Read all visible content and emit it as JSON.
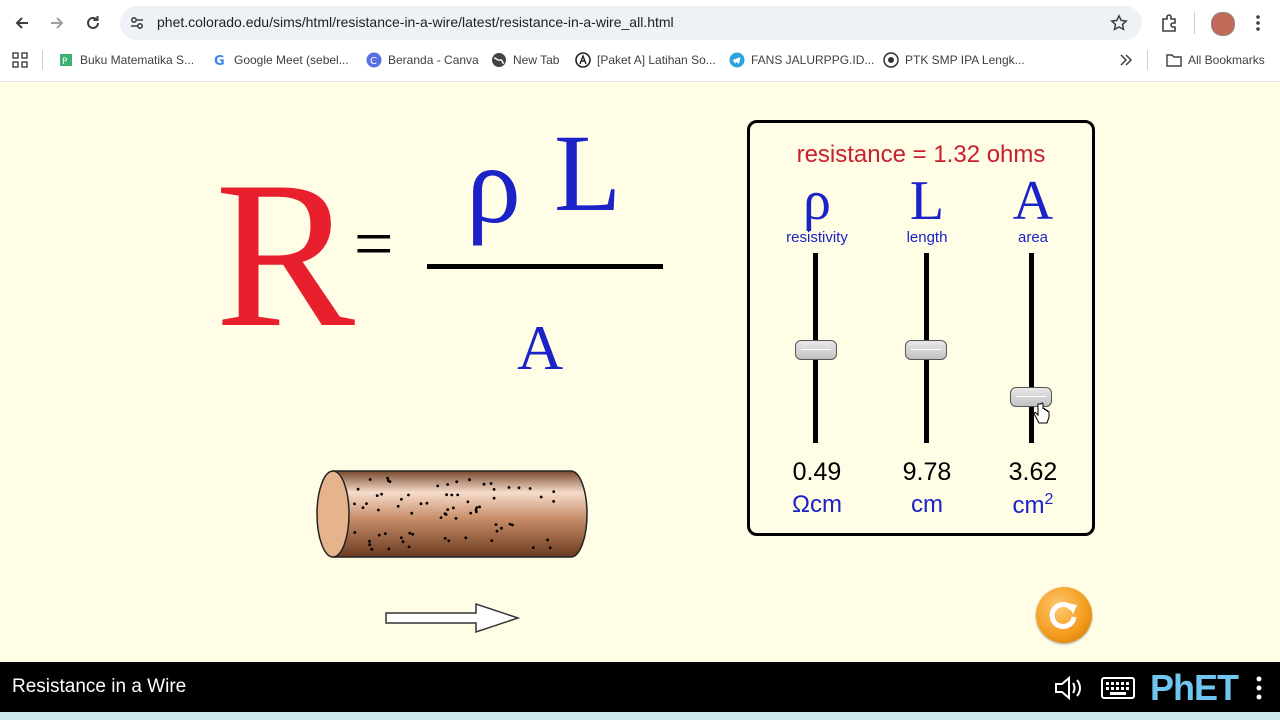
{
  "browser": {
    "url": "phet.colorado.edu/sims/html/resistance-in-a-wire/latest/resistance-in-a-wire_all.html",
    "bookmarks": [
      {
        "label": "Buku Matematika S...",
        "icon": "buku-favicon"
      },
      {
        "label": "Google Meet (sebel...",
        "icon": "google-icon"
      },
      {
        "label": "Beranda - Canva",
        "icon": "canva-icon"
      },
      {
        "label": "New Tab",
        "icon": "globe-icon"
      },
      {
        "label": "[Paket A] Latihan So...",
        "icon": "paket-favicon"
      },
      {
        "label": "FANS JALURPPG.ID...",
        "icon": "telegram-icon"
      },
      {
        "label": "PTK SMP IPA Lengk...",
        "icon": "ptk-favicon"
      }
    ],
    "all_bookmarks": "All Bookmarks"
  },
  "equation": {
    "R": "R",
    "equals": "=",
    "rho": "ρ",
    "L": "L",
    "A": "A"
  },
  "panel": {
    "resistance_text": "resistance = 1.32 ohms",
    "sliders": [
      {
        "symbol": "ρ",
        "label": "resistivity",
        "value": "0.49",
        "unit": "Ωcm",
        "unit_sup": ""
      },
      {
        "symbol": "L",
        "label": "length",
        "value": "9.78",
        "unit": "cm",
        "unit_sup": ""
      },
      {
        "symbol": "A",
        "label": "area",
        "value": "3.62",
        "unit": "cm",
        "unit_sup": "2"
      }
    ]
  },
  "footer": {
    "title": "Resistance in a Wire",
    "logo": "PhET"
  },
  "colors": {
    "background": "#fffde6",
    "R": "#e8202e",
    "blue": "#1b22c8",
    "resistance": "#c8202e",
    "wire": "#b87a55"
  }
}
